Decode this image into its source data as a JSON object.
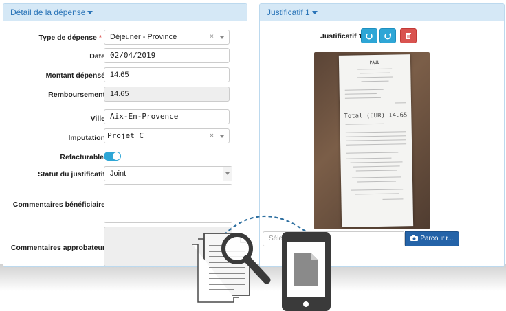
{
  "left_panel": {
    "title": "Détail de la dépense",
    "fields": {
      "type_label": "Type de dépense",
      "type_required": "*",
      "type_value": "Déjeuner - Province",
      "type_clear": "×",
      "date_label": "Date",
      "date_value": "02/04/2019",
      "montant_label": "Montant dépensé",
      "montant_value": "14.65",
      "rembourse_label": "Remboursement",
      "rembourse_value": "14.65",
      "ville_label": "Ville",
      "ville_value": "Aix-En-Provence",
      "imputation_label": "Imputation",
      "imputation_value": "Projet  C",
      "imputation_clear": "×",
      "refacturable_label": "Refacturable",
      "refacturable_on": true,
      "statut_label": "Statut du justificatif",
      "statut_value": "Joint",
      "commentaires_benef_label": "Commentaires bénéficiaire",
      "commentaires_appro_label": "Commentaires approbateur"
    }
  },
  "right_panel": {
    "title": "Justificatif 1",
    "doc_label": "Justificatif 1",
    "buttons": {
      "rotate_left": "rotate-left-icon",
      "rotate_right": "rotate-right-icon",
      "delete": "trash-icon"
    },
    "receipt": {
      "header": "PAUL",
      "total_label": "Total (EUR)",
      "total_value": "14.65"
    },
    "file_placeholder": "Séle",
    "browse_label": "Parcourir..."
  },
  "colors": {
    "panel_header_bg": "#d5e8f6",
    "accent": "#2ea6d6",
    "danger": "#d9534f",
    "browse": "#2463a8"
  }
}
